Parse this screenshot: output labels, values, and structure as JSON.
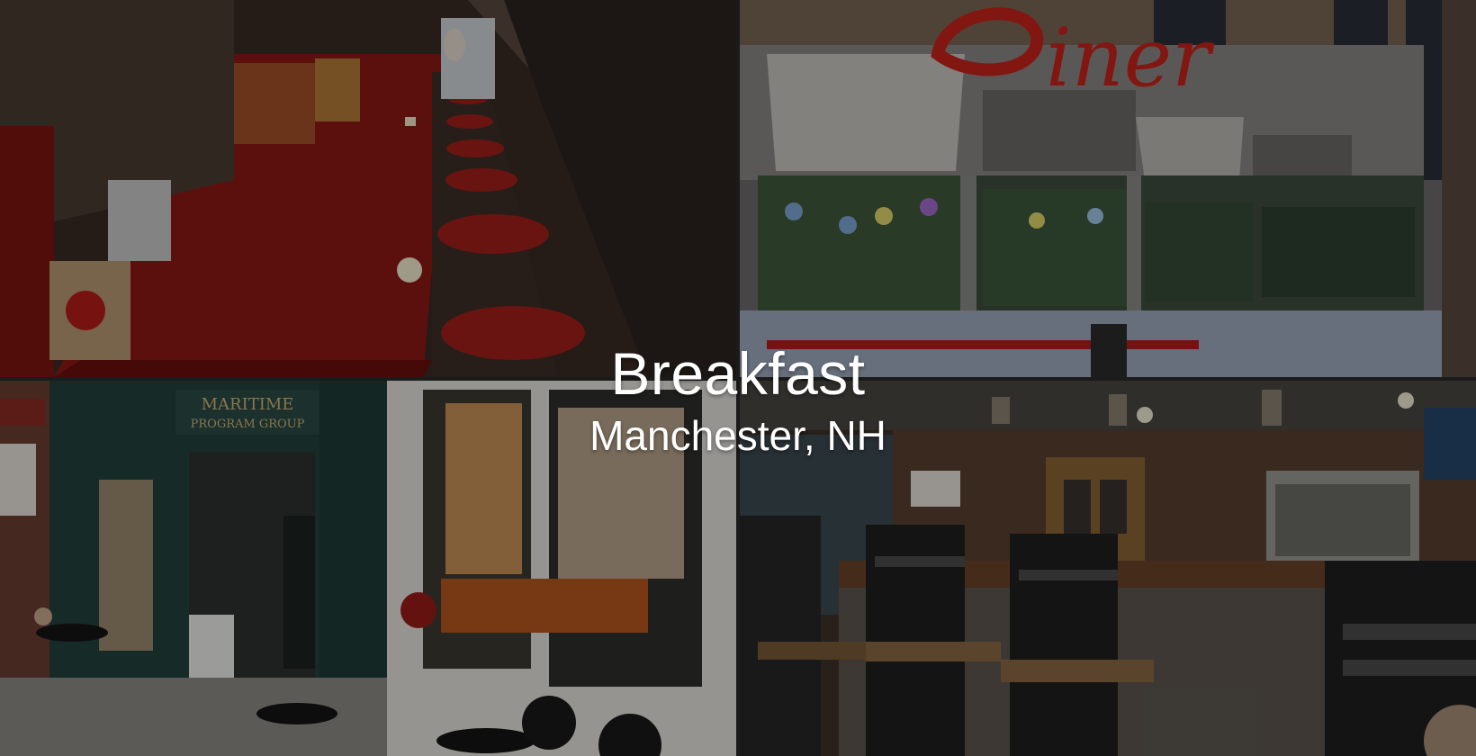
{
  "overlay": {
    "title": "Breakfast",
    "subtitle": "Manchester, NH"
  },
  "photos": [
    {
      "name": "diner-counter-photo",
      "icon": "diner-counter-with-red-stools"
    },
    {
      "name": "diner-exterior-photo",
      "icon": "diner-neon-sign-storefront",
      "sign_text": "Diner"
    },
    {
      "name": "bridge-cafe-storefront-photo",
      "icon": "cafe-storefront-with-patio",
      "sign_text": "MARITIME PROGRAM GROUP"
    },
    {
      "name": "cafe-interior-photo",
      "icon": "cafe-counter-with-bar-stools"
    }
  ],
  "colors": {
    "counter_red": "#8e1a16",
    "neon_red": "#c8241c",
    "storefront_teal": "#1f3b38",
    "wood_brown": "#4a3424"
  }
}
